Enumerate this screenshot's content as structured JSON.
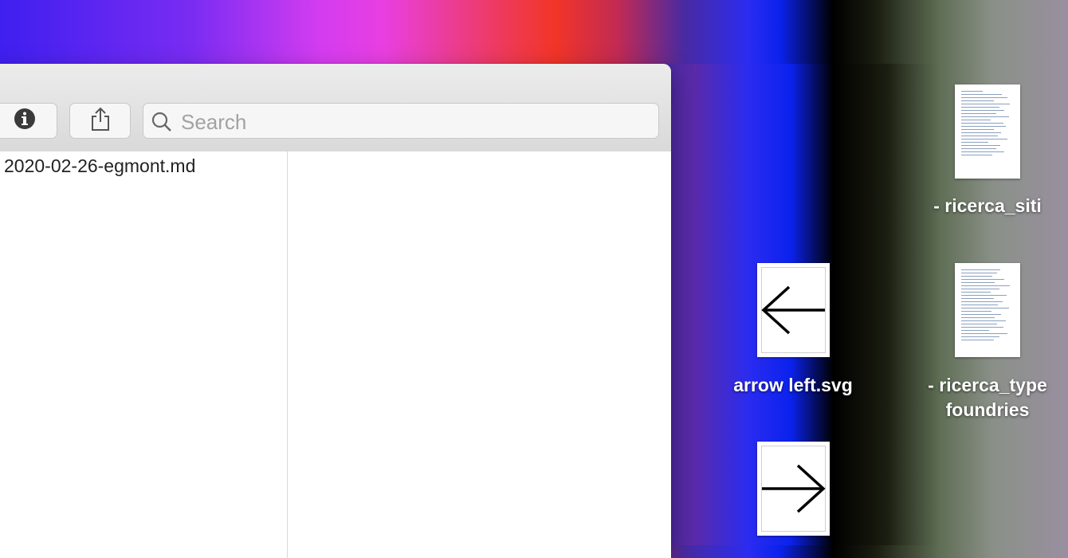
{
  "window": {
    "toolbar": {
      "info_icon": "info-icon",
      "share_icon": "share-icon",
      "search": {
        "placeholder": "Search",
        "value": ""
      }
    },
    "file_list": [
      {
        "name": "2020-02-26-egmont.md"
      }
    ]
  },
  "desktop": {
    "items": [
      {
        "label": "- ricerca_siti",
        "icon": "document-thumbnail-icon"
      },
      {
        "label": "arrow left.svg",
        "icon": "arrow-left-icon"
      },
      {
        "label_line1": "- ricerca_type",
        "label_line2": "foundries",
        "icon": "document-thumbnail-icon"
      },
      {
        "label": "",
        "icon": "arrow-right-icon"
      }
    ]
  }
}
